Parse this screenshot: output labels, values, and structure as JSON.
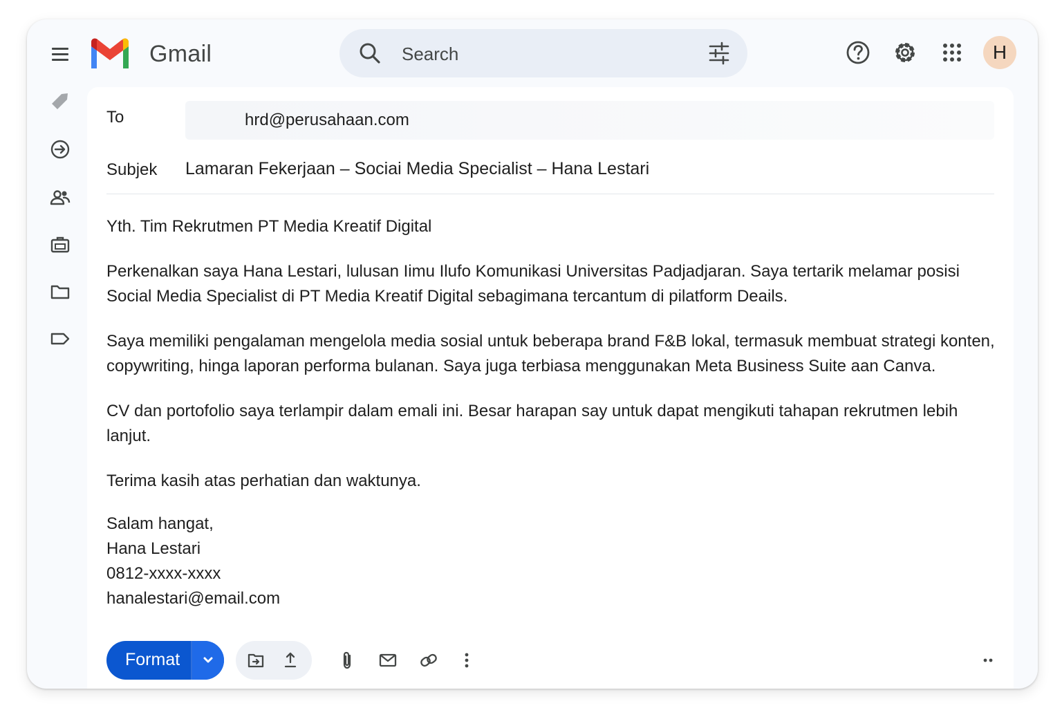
{
  "header": {
    "app_name": "Gmail",
    "search_placeholder": "Search",
    "avatar_letter": "H"
  },
  "compose": {
    "to_label": "To",
    "to_value": "hrd@perusahaan.com",
    "subject_label": "Subjek",
    "subject_value": "Lamaran Fekerjaan – Sociai Media Specialist – Hana Lestari",
    "body": {
      "greeting": "Yth. Tim Rekrutmen PT Media Kreatif Digital",
      "paragraph1": "Perkenalkan saya Hana Lestari, lulusan Iimu Ilufo Komunikasi Universitas Padjadjaran.  Saya tertarik melamar posisi Social Media Specialist di PT Media Kreatif Digital sebagimana tercantum di pilatform Deails.",
      "paragraph2": "Saya memiliki pengalaman mengelola media sosial untuk beberapa brand F&B lokal, termasuk membuat strategi konten, copywriting, hinga laporan performa bulanan. Saya juga terbiasa menggunakan Meta Business Suite aan Canva.",
      "paragraph3": "CV dan portofolio saya terlampir dalam emali ini. Besar harapan say untuk dapat mengikuti tahapan rekrutmen lebih lanjut.",
      "thanks": "Terima kasih atas perhatian dan waktunya.",
      "closing": "Salam hangat,",
      "name": "Hana Lestari",
      "phone": "0812-xxxx-xxxx",
      "email": "hanalestari@email.com"
    }
  },
  "toolbar": {
    "format_label": "Format"
  },
  "icons": {
    "menu": "menu-icon",
    "search": "search-icon",
    "filter": "tune-icon",
    "help": "help-icon",
    "settings": "gear-icon",
    "apps": "apps-grid-icon",
    "rail": [
      "tag-icon",
      "circle-arrow-icon",
      "contacts-icon",
      "briefcase-icon",
      "folder-icon",
      "label-icon"
    ],
    "bottom": [
      "chevron-down-icon",
      "insert-file-icon",
      "upload-icon",
      "attach-icon",
      "mail-icon",
      "link-icon",
      "more-vert-icon",
      "more-horiz-icon"
    ]
  },
  "colors": {
    "accent": "#0b57d0",
    "search_bg": "#e9eef6",
    "avatar_bg": "#f5d7bf",
    "window_bg": "#f8fafd"
  }
}
